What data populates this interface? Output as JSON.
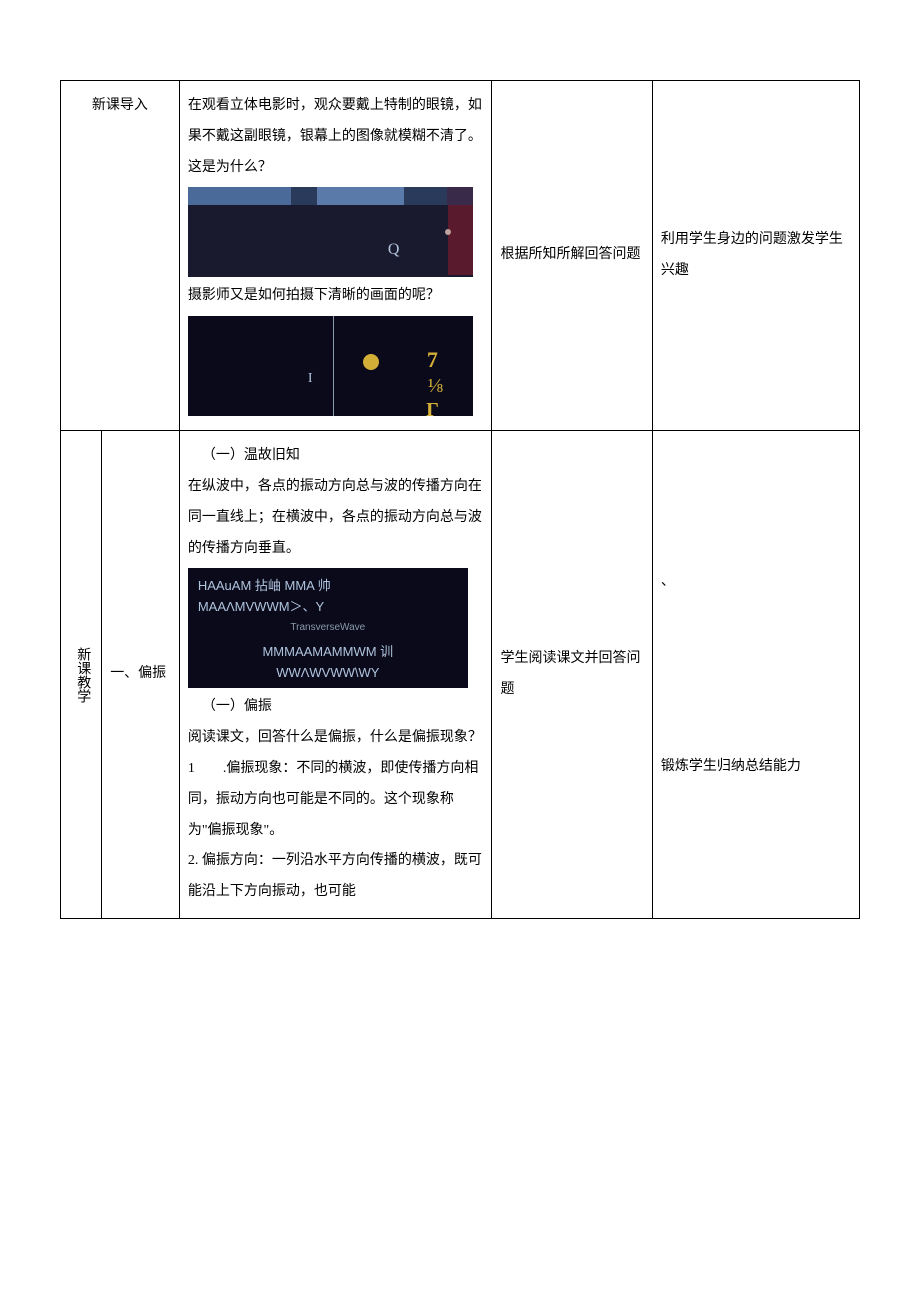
{
  "row1": {
    "section_label": "新课导入",
    "content_p1": "在观看立体电影时，观众要戴上特制的眼镜，如果不戴这副眼镜，银幕上的图像就模糊不清了。这是为什么？",
    "content_p2": "摄影师又是如何拍摄下清晰的画面的呢？",
    "img1_q": "Q",
    "img2_i": "I",
    "img2_seven": "7",
    "img2_eighth": "⅛",
    "img2_gamma": "Γ",
    "student_activity": "根据所知所解回答问题",
    "purpose": "利用学生身边的问题激发学生兴趣"
  },
  "row2": {
    "vertical_label": "新课教学",
    "section_label": "一、偏振",
    "heading1": "（一）温故旧知",
    "content_p1": "在纵波中，各点的振动方向总与波的传播方向在同一直线上；在横波中，各点的振动方向总与波的传播方向垂直。",
    "img3_line1a": "HAAuAM 拈岫 MMA 帅",
    "img3_line1b": "MAAΛMVWWM＞、Y",
    "img3_tw": "TransverseWave",
    "img3_line2a": "MMMAAMAMMWM 训",
    "img3_line2b": "WWΛWVWW\\WY",
    "heading2": "（一）偏振",
    "content_p2": "阅读课文，回答什么是偏振，什么是偏振现象？",
    "content_p3_num": "1",
    "content_p3": ".偏振现象：不同的横波，即使传播方向相同，振动方向也可能是不同的。这个现象称为\"偏振现象\"。",
    "content_p4": "2. 偏振方向：一列沿水平方向传播的横波，既可能沿上下方向振动，也可能",
    "student_activity": "学生阅读课文并回答问题",
    "purpose_tick": "、",
    "purpose": "锻炼学生归纳总结能力"
  }
}
